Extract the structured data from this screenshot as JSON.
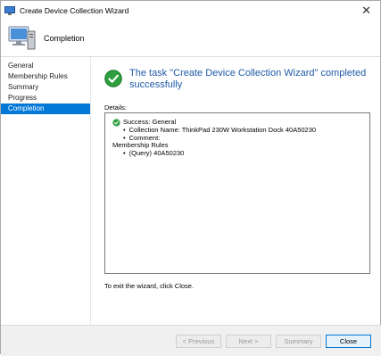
{
  "window": {
    "title": "Create Device Collection Wizard",
    "close_glyph": "✕"
  },
  "header": {
    "title": "Completion",
    "icon": "computer-icon"
  },
  "sidebar": {
    "items": [
      {
        "label": "General",
        "active": false
      },
      {
        "label": "Membership Rules",
        "active": false
      },
      {
        "label": "Summary",
        "active": false
      },
      {
        "label": "Progress",
        "active": false
      },
      {
        "label": "Completion",
        "active": true
      }
    ]
  },
  "main": {
    "status_message": "The task \"Create Device Collection Wizard\" completed successfully",
    "details_label": "Details:",
    "details": {
      "success_line": "Success: General",
      "collection_name": "Collection Name: ThinkPad 230W Workstation Dock 40A50230",
      "comment": "Comment:",
      "rules_header": "Membership Rules",
      "rule_item": "(Query) 40A50230",
      "bullet": "•"
    },
    "exit_text": "To exit the wizard, click Close."
  },
  "footer": {
    "previous_label": "< Previous",
    "next_label": "Next >",
    "summary_label": "Summary",
    "close_label": "Close"
  },
  "colors": {
    "accent": "#0078d7",
    "status_text": "#1e5aa8",
    "success_green": "#2e9e3e"
  }
}
